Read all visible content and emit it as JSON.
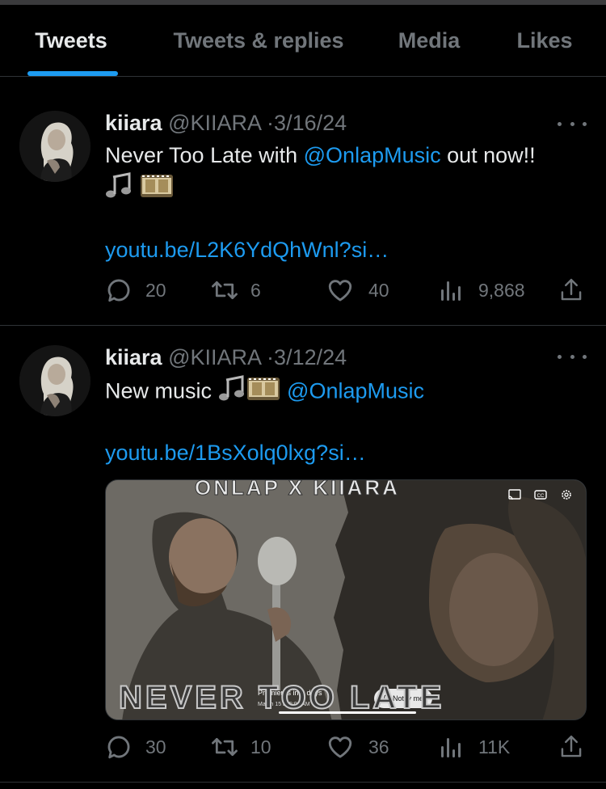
{
  "tabs": [
    {
      "label": "Tweets",
      "active": true
    },
    {
      "label": "Tweets & replies",
      "active": false
    },
    {
      "label": "Media",
      "active": false
    },
    {
      "label": "Likes",
      "active": false
    }
  ],
  "tweets": [
    {
      "name": "kiiara",
      "handle": "@KIIARA",
      "separator": "·",
      "date": "3/16/24",
      "text_before": "Never Too Late with ",
      "mention": "@OnlapMusic",
      "text_after": " out now!!",
      "link": "youtu.be/L2K6YdQhWnl?si…",
      "stats": {
        "replies": "20",
        "retweets": "6",
        "likes": "40",
        "views": "9,868"
      }
    },
    {
      "name": "kiiara",
      "handle": "@KIIARA",
      "separator": "·",
      "date": "3/12/24",
      "text_before": "New music ",
      "mention": "@OnlapMusic",
      "link": "youtu.be/1BsXolq0lxg?si…",
      "media": {
        "top_title": "ONLAP X KIIARA",
        "bottom_title": "NEVER TOO LATE",
        "premiere_text": "Premieres in 2 days",
        "premiere_time": "March 15 at 5:00 AM",
        "notify_label": "Notify me"
      },
      "stats": {
        "replies": "30",
        "retweets": "10",
        "likes": "36",
        "views": "11K"
      }
    }
  ],
  "colors": {
    "accent": "#1d9bf0",
    "muted": "#71767b",
    "text": "#e7e9ea",
    "background": "#000000"
  }
}
